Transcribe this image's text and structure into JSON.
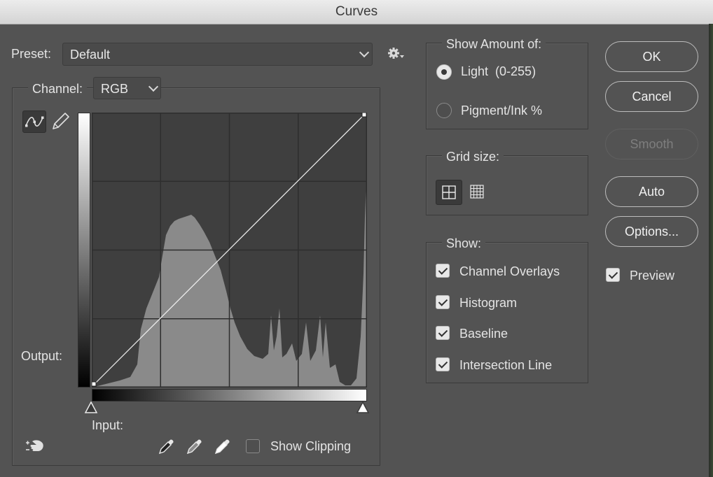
{
  "window": {
    "title": "Curves"
  },
  "preset": {
    "label": "Preset:",
    "value": "Default",
    "gear_icon": "gear-icon"
  },
  "channel": {
    "label": "Channel:",
    "value": "RGB"
  },
  "graph": {
    "output_label": "Output:",
    "input_label": "Input:",
    "grid_divisions": 4,
    "curve_points": [
      [
        0,
        0
      ],
      [
        255,
        255
      ]
    ],
    "tools": [
      "curve-point-icon",
      "pencil-icon"
    ]
  },
  "clipping": {
    "label": "Show Clipping",
    "checked": false
  },
  "eyedroppers": [
    "black-point-eyedropper-icon",
    "gray-point-eyedropper-icon",
    "white-point-eyedropper-icon"
  ],
  "show_amount": {
    "title": "Show Amount of:",
    "options": [
      {
        "label": "Light  (0-255)",
        "selected": true
      },
      {
        "label": "Pigment/Ink %",
        "selected": false
      }
    ]
  },
  "grid_size": {
    "title": "Grid size:",
    "options": [
      "simple-grid-icon",
      "detailed-grid-icon"
    ],
    "selected": 0
  },
  "show": {
    "title": "Show:",
    "items": [
      {
        "label": "Channel Overlays",
        "checked": true
      },
      {
        "label": "Histogram",
        "checked": true
      },
      {
        "label": "Baseline",
        "checked": true
      },
      {
        "label": "Intersection Line",
        "checked": true
      }
    ]
  },
  "buttons": {
    "ok": "OK",
    "cancel": "Cancel",
    "smooth": "Smooth",
    "auto": "Auto",
    "options": "Options..."
  },
  "preview": {
    "label": "Preview",
    "checked": true
  },
  "colors": {
    "background": "#535353",
    "graph_bg": "#3f3f3f",
    "histogram": "#8a8a8a",
    "text": "#e8e8e8"
  }
}
